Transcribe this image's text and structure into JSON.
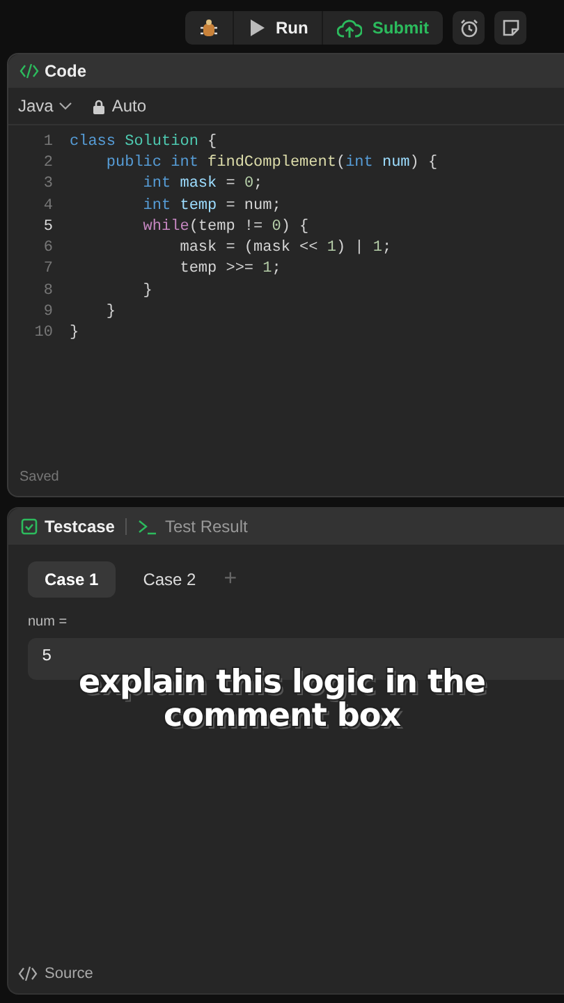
{
  "toolbar": {
    "buttons": [
      {
        "kind": "debug"
      },
      {
        "kind": "run",
        "label": "Run"
      },
      {
        "kind": "submit",
        "label": "Submit"
      }
    ],
    "tools": [
      {
        "kind": "timer"
      },
      {
        "kind": "note"
      }
    ]
  },
  "code_panel": {
    "title": "Code",
    "language": "Java",
    "mode": "Auto",
    "status": "Saved",
    "lines": [
      {
        "number": "1",
        "active": false,
        "tokens": [
          {
            "text": "class ",
            "kind": "keyword"
          },
          {
            "text": "Solution",
            "kind": "type"
          },
          {
            "text": " {",
            "kind": "plain"
          }
        ]
      },
      {
        "number": "2",
        "active": false,
        "tokens": [
          {
            "text": "    public int ",
            "kind": "keyword"
          },
          {
            "text": "findComplement",
            "kind": "function"
          },
          {
            "text": "(",
            "kind": "plain"
          },
          {
            "text": "int ",
            "kind": "keyword"
          },
          {
            "text": "num",
            "kind": "variable"
          },
          {
            "text": ") {",
            "kind": "plain"
          }
        ]
      },
      {
        "number": "3",
        "active": false,
        "tokens": [
          {
            "text": "        int ",
            "kind": "keyword"
          },
          {
            "text": "mask",
            "kind": "variable"
          },
          {
            "text": " = ",
            "kind": "plain"
          },
          {
            "text": "0",
            "kind": "number"
          },
          {
            "text": ";",
            "kind": "plain"
          }
        ]
      },
      {
        "number": "4",
        "active": false,
        "tokens": [
          {
            "text": "        int ",
            "kind": "keyword"
          },
          {
            "text": "temp",
            "kind": "variable"
          },
          {
            "text": " = num;",
            "kind": "plain"
          }
        ]
      },
      {
        "number": "5",
        "active": true,
        "tokens": [
          {
            "text": "        while",
            "kind": "control"
          },
          {
            "text": "(temp != ",
            "kind": "plain"
          },
          {
            "text": "0",
            "kind": "number"
          },
          {
            "text": ") {",
            "kind": "plain"
          }
        ]
      },
      {
        "number": "6",
        "active": false,
        "tokens": [
          {
            "text": "            mask = (mask << ",
            "kind": "plain"
          },
          {
            "text": "1",
            "kind": "number"
          },
          {
            "text": ") | ",
            "kind": "plain"
          },
          {
            "text": "1",
            "kind": "number"
          },
          {
            "text": ";",
            "kind": "plain"
          }
        ]
      },
      {
        "number": "7",
        "active": false,
        "tokens": [
          {
            "text": "            temp >>= ",
            "kind": "plain"
          },
          {
            "text": "1",
            "kind": "number"
          },
          {
            "text": ";",
            "kind": "plain"
          }
        ]
      },
      {
        "number": "8",
        "active": false,
        "tokens": [
          {
            "text": "        }",
            "kind": "plain"
          }
        ]
      },
      {
        "number": "9",
        "active": false,
        "tokens": [
          {
            "text": "    }",
            "kind": "plain"
          }
        ]
      },
      {
        "number": "10",
        "active": false,
        "tokens": [
          {
            "text": "}",
            "kind": "plain"
          }
        ]
      }
    ]
  },
  "test_panel": {
    "tabs": [
      {
        "label": "Testcase",
        "selected": true,
        "kind": "check"
      },
      {
        "label": "Test Result",
        "selected": false,
        "kind": "terminal"
      }
    ],
    "cases": [
      {
        "label": "Case 1",
        "selected": true
      },
      {
        "label": "Case 2",
        "selected": false
      }
    ],
    "add_case": "+",
    "param_label": "num =",
    "param_value": "5",
    "footer": "Source"
  },
  "caption": [
    "explain this logic in the",
    "comment box"
  ]
}
